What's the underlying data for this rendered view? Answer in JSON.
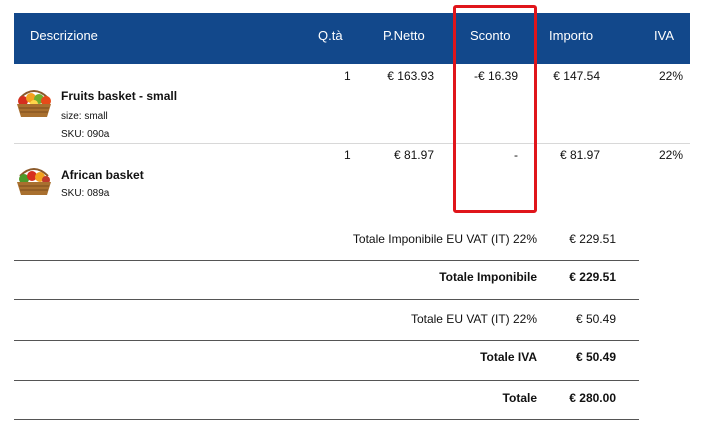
{
  "header": {
    "descrizione": "Descrizione",
    "qta": "Q.tà",
    "pnetto": "P.Netto",
    "sconto": "Sconto",
    "importo": "Importo",
    "iva": "IVA"
  },
  "items": [
    {
      "name": "Fruits basket - small",
      "size": "size: small",
      "sku": "SKU:  090a",
      "qty": "1",
      "pnetto": "€ 163.93",
      "sconto": "-€ 16.39",
      "importo": "€ 147.54",
      "iva": "22%",
      "image_icon": "fruit-basket"
    },
    {
      "name": "African basket",
      "sku": "SKU:  089a",
      "qty": "1",
      "pnetto": "€ 81.97",
      "sconto": "-",
      "importo": "€ 81.97",
      "iva": "22%",
      "image_icon": "fruit-basket"
    }
  ],
  "totals": [
    {
      "label": "Totale Imponibile EU VAT (IT) 22%",
      "value": "€ 229.51",
      "bold": false
    },
    {
      "label": "Totale Imponibile",
      "value": "€ 229.51",
      "bold": true
    },
    {
      "label": "Totale EU VAT (IT) 22%",
      "value": "€ 50.49",
      "bold": false
    },
    {
      "label": "Totale IVA",
      "value": "€ 50.49",
      "bold": true
    },
    {
      "label": "Totale",
      "value": "€ 280.00",
      "bold": true
    }
  ],
  "colors": {
    "header_bg": "#12488b",
    "highlight": "#e0151b"
  }
}
